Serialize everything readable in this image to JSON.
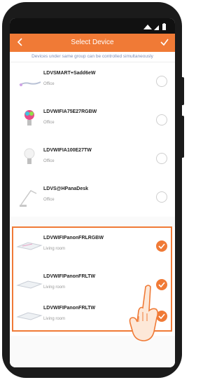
{
  "header": {
    "title": "Select Device",
    "back_icon": "chevron-left-icon",
    "confirm_icon": "checkmark-icon"
  },
  "notice": "Devices under same group can be controlled simultaneously",
  "devices": [
    {
      "name": "LDVSMART+Sadd6eW",
      "room": "Office",
      "selected": false
    },
    {
      "name": "LDVWIFIA75E27RGBW",
      "room": "Office",
      "selected": false
    },
    {
      "name": "LDVWIFIA100E27TW",
      "room": "Office",
      "selected": false
    },
    {
      "name": "LDVS@HPanaDesk",
      "room": "Office",
      "selected": false
    },
    {
      "name": "LDVWIFIPanonFRLRGBW",
      "room": "Living room",
      "selected": true
    },
    {
      "name": "LDVWIFIPanonFRLTW",
      "room": "Living room",
      "selected": true
    },
    {
      "name": "LDVWIFIPanonFRLTW",
      "room": "Living room",
      "selected": true
    }
  ],
  "colors": {
    "accent": "#f07a36",
    "notice_text": "#7d8fb8",
    "device_frame": "#1b1b1b"
  }
}
